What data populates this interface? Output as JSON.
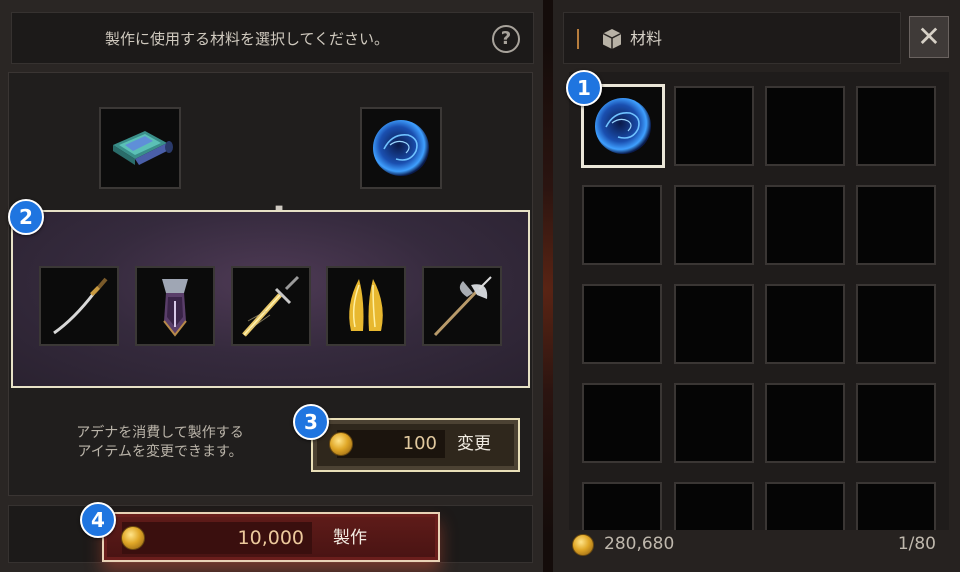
{
  "craft": {
    "instruction": "製作に使用する材料を選択してください。",
    "help_label": "?",
    "plus": "+",
    "change_hint_line1": "アデナを消費して製作する",
    "change_hint_line2": "アイテムを変更できます。",
    "change_cost": "100",
    "change_label": "変更",
    "craft_cost": "10,000",
    "craft_label": "製作"
  },
  "inventory": {
    "title": "材料",
    "close_label": "✕",
    "gold": "280,680",
    "slot_count": "1/80"
  },
  "callouts": [
    "1",
    "2",
    "3",
    "4"
  ]
}
